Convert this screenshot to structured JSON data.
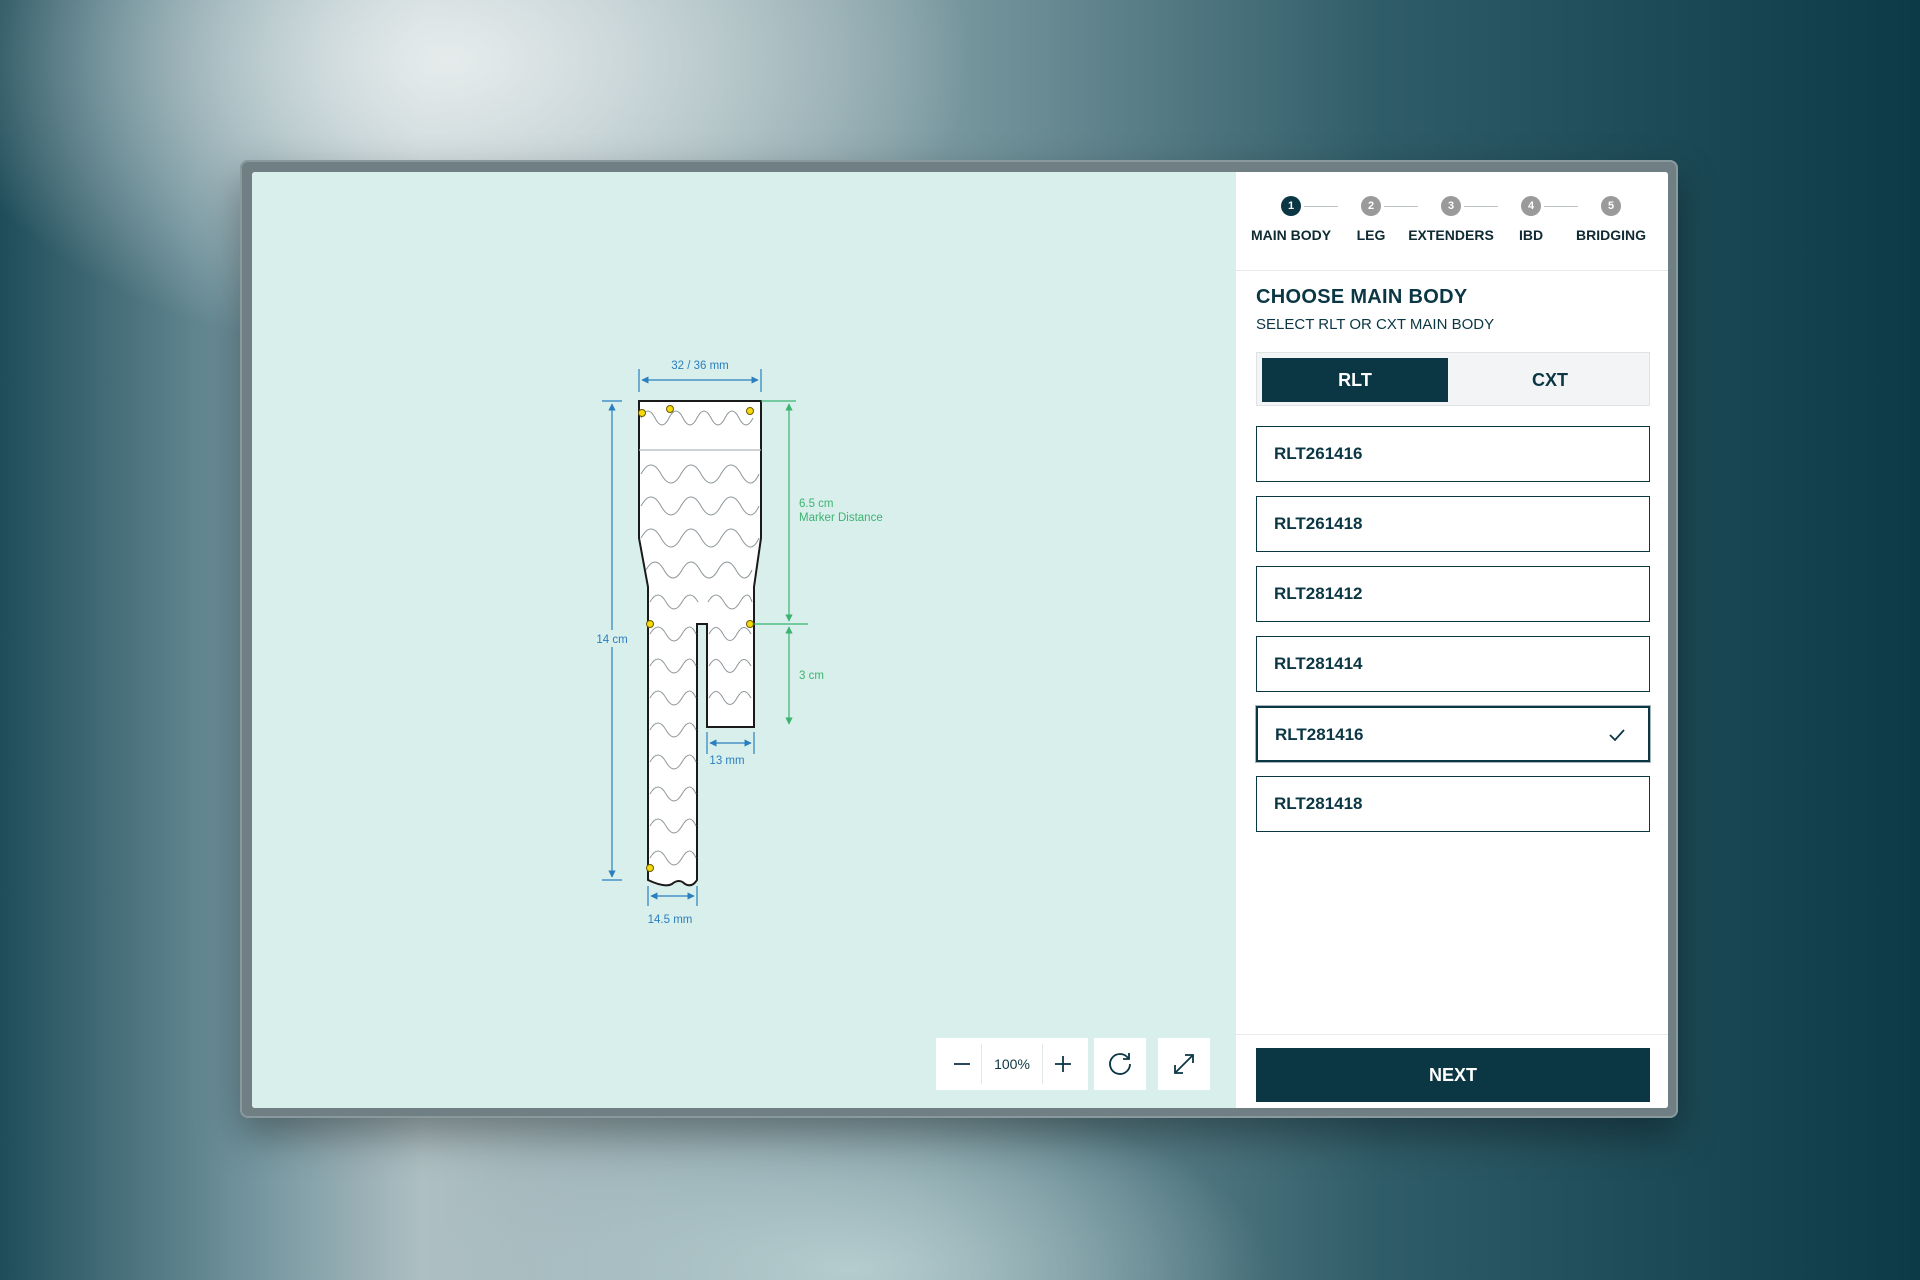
{
  "stepper": {
    "steps": [
      {
        "number": "1",
        "label": "MAIN BODY"
      },
      {
        "number": "2",
        "label": "LEG"
      },
      {
        "number": "3",
        "label": "EXTENDERS"
      },
      {
        "number": "4",
        "label": "IBD"
      },
      {
        "number": "5",
        "label": "BRIDGING"
      }
    ],
    "active_step": 1
  },
  "panel": {
    "title": "CHOOSE MAIN BODY",
    "subtitle": "SELECT RLT OR CXT MAIN BODY",
    "segments": {
      "selected": "RLT",
      "options": [
        "RLT",
        "CXT"
      ]
    },
    "items": [
      "RLT261416",
      "RLT261418",
      "RLT281412",
      "RLT281414",
      "RLT281416",
      "RLT281418"
    ],
    "selected_item": "RLT281416",
    "next_label": "NEXT"
  },
  "diagram": {
    "top_width": "32 / 36 mm",
    "length": "14 cm",
    "marker_distance_value": "6.5 cm",
    "marker_distance_label": "Marker Distance",
    "short_leg_length": "3 cm",
    "short_leg_width": "13 mm",
    "long_leg_width": "14.5 mm"
  },
  "zoom": {
    "level": "100%"
  },
  "colors": {
    "primary": "#0b3644",
    "canvas": "#d9efec",
    "dimension_blue": "#2a7fbf",
    "dimension_green": "#3cb371",
    "marker": "#f5d90a"
  }
}
